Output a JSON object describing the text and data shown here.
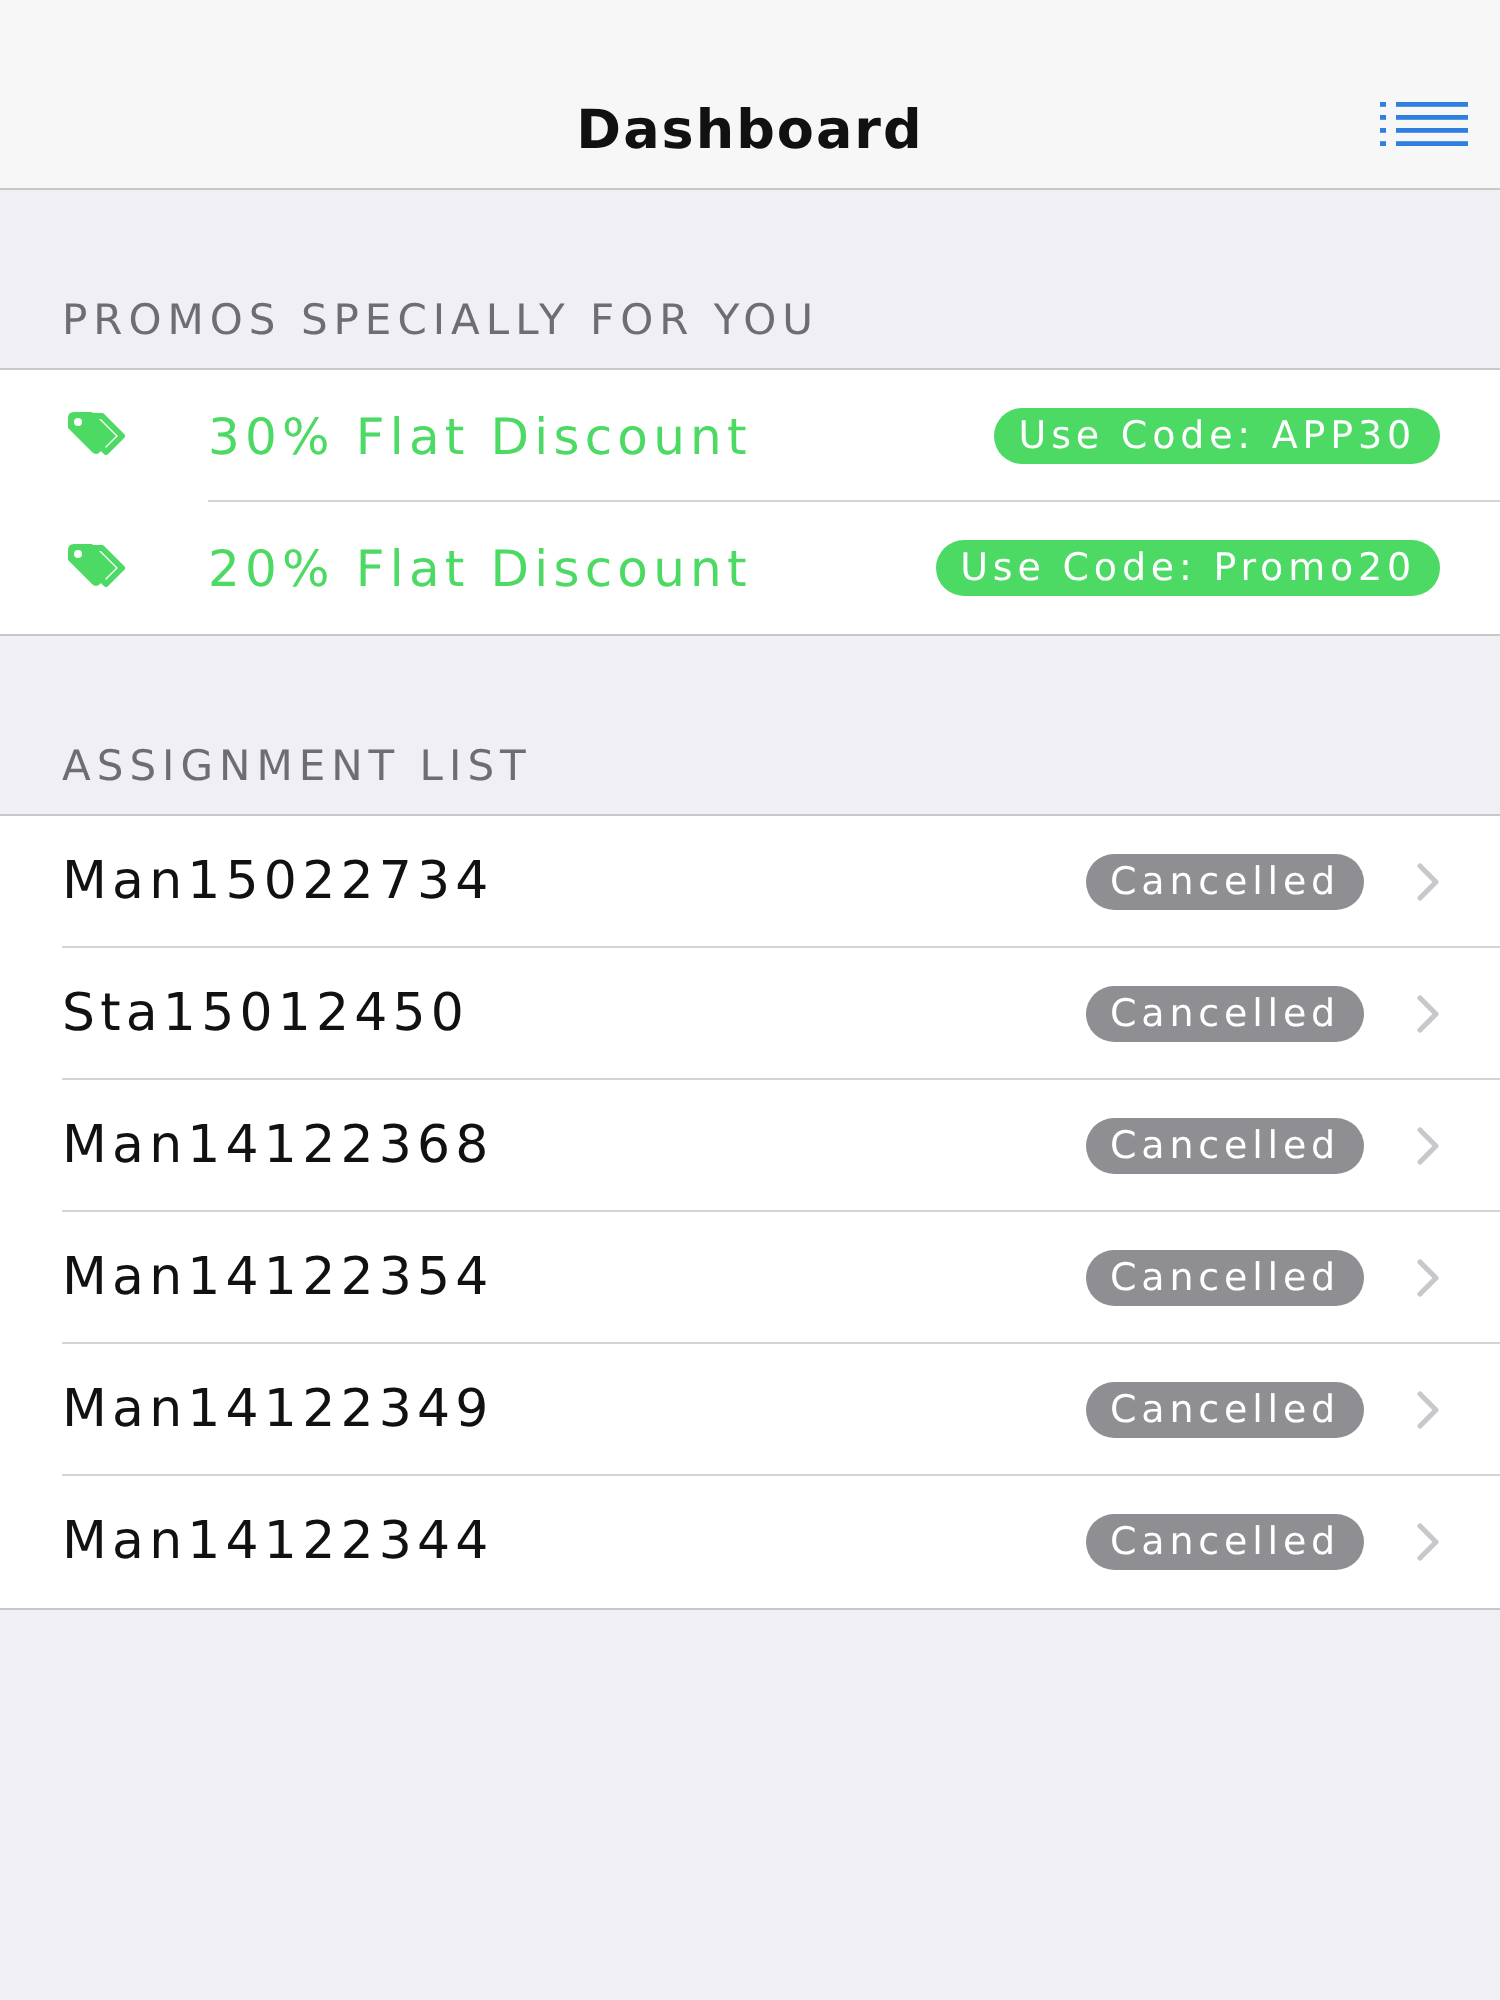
{
  "nav_bar": {
    "title": "Dashboard"
  },
  "promos": {
    "header": "PROMOS SPECIALLY FOR YOU",
    "items": [
      {
        "title": "30% Flat Discount",
        "code": "Use Code: APP30"
      },
      {
        "title": "20% Flat Discount",
        "code": "Use Code: Promo20"
      }
    ]
  },
  "assignments": {
    "header": "ASSIGNMENT LIST",
    "rows": [
      {
        "id": "Man15022734",
        "status": "Cancelled"
      },
      {
        "id": "Sta15012450",
        "status": "Cancelled"
      },
      {
        "id": "Man14122368",
        "status": "Cancelled"
      },
      {
        "id": "Man14122354",
        "status": "Cancelled"
      },
      {
        "id": "Man14122349",
        "status": "Cancelled"
      },
      {
        "id": "Man14122344",
        "status": "Cancelled"
      }
    ]
  }
}
